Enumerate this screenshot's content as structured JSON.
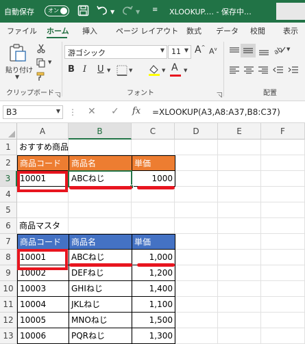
{
  "titlebar": {
    "autosave_label": "自動保存",
    "toggle_label": "オン",
    "filename": "XLOOKUP.… - 保存中…",
    "colors": {
      "bg": "#217346"
    },
    "icons": [
      "save-icon",
      "undo-icon",
      "redo-icon"
    ]
  },
  "tabs": [
    "ファイル",
    "ホーム",
    "挿入",
    "ページ レイアウト",
    "数式",
    "データ",
    "校閲",
    "表示"
  ],
  "active_tab": "ホーム",
  "ribbon": {
    "clipboard": {
      "paste_label": "貼り付け",
      "group_label": "クリップボード"
    },
    "font": {
      "font_name": "游ゴシック",
      "font_size": "11",
      "bold": "B",
      "italic": "I",
      "underline": "U",
      "grow": "A",
      "shrink": "A",
      "font_color_letter": "A",
      "group_label": "フォント"
    },
    "alignment": {
      "group_label": "配置"
    }
  },
  "formula_bar": {
    "name_box": "B3",
    "fx": "fx",
    "formula": "=XLOOKUP(A3,A8:A37,B8:C37)"
  },
  "grid": {
    "columns": [
      "A",
      "B",
      "C",
      "D",
      "E",
      "F"
    ],
    "selected_column": "B",
    "rows": [
      "1",
      "2",
      "3",
      "4",
      "5",
      "6",
      "7",
      "8",
      "9",
      "10",
      "11",
      "12",
      "13"
    ],
    "selected_row": "3",
    "cells": {
      "A1": "おすすめ商品",
      "A2": "商品コード",
      "B2": "商品名",
      "C2": "単価",
      "A3": "10001",
      "B3": "ABCねじ",
      "C3": "1000",
      "A6": "商品マスタ",
      "A7": "商品コード",
      "B7": "商品名",
      "C7": "単価",
      "A8": "10001",
      "B8": "ABCねじ",
      "C8": "1,000",
      "A9": "10002",
      "B9": "DEFねじ",
      "C9": "1,200",
      "A10": "10003",
      "B10": "GHIねじ",
      "C10": "1,400",
      "A11": "10004",
      "B11": "JKLねじ",
      "C11": "1,100",
      "A12": "10005",
      "B12": "MNOねじ",
      "C12": "1,500",
      "A13": "10006",
      "B13": "PQRねじ",
      "C13": "1,300"
    },
    "colors": {
      "header_orange": "#ed7d31",
      "header_blue": "#4472c4",
      "annotation_red": "#e8151f"
    }
  }
}
